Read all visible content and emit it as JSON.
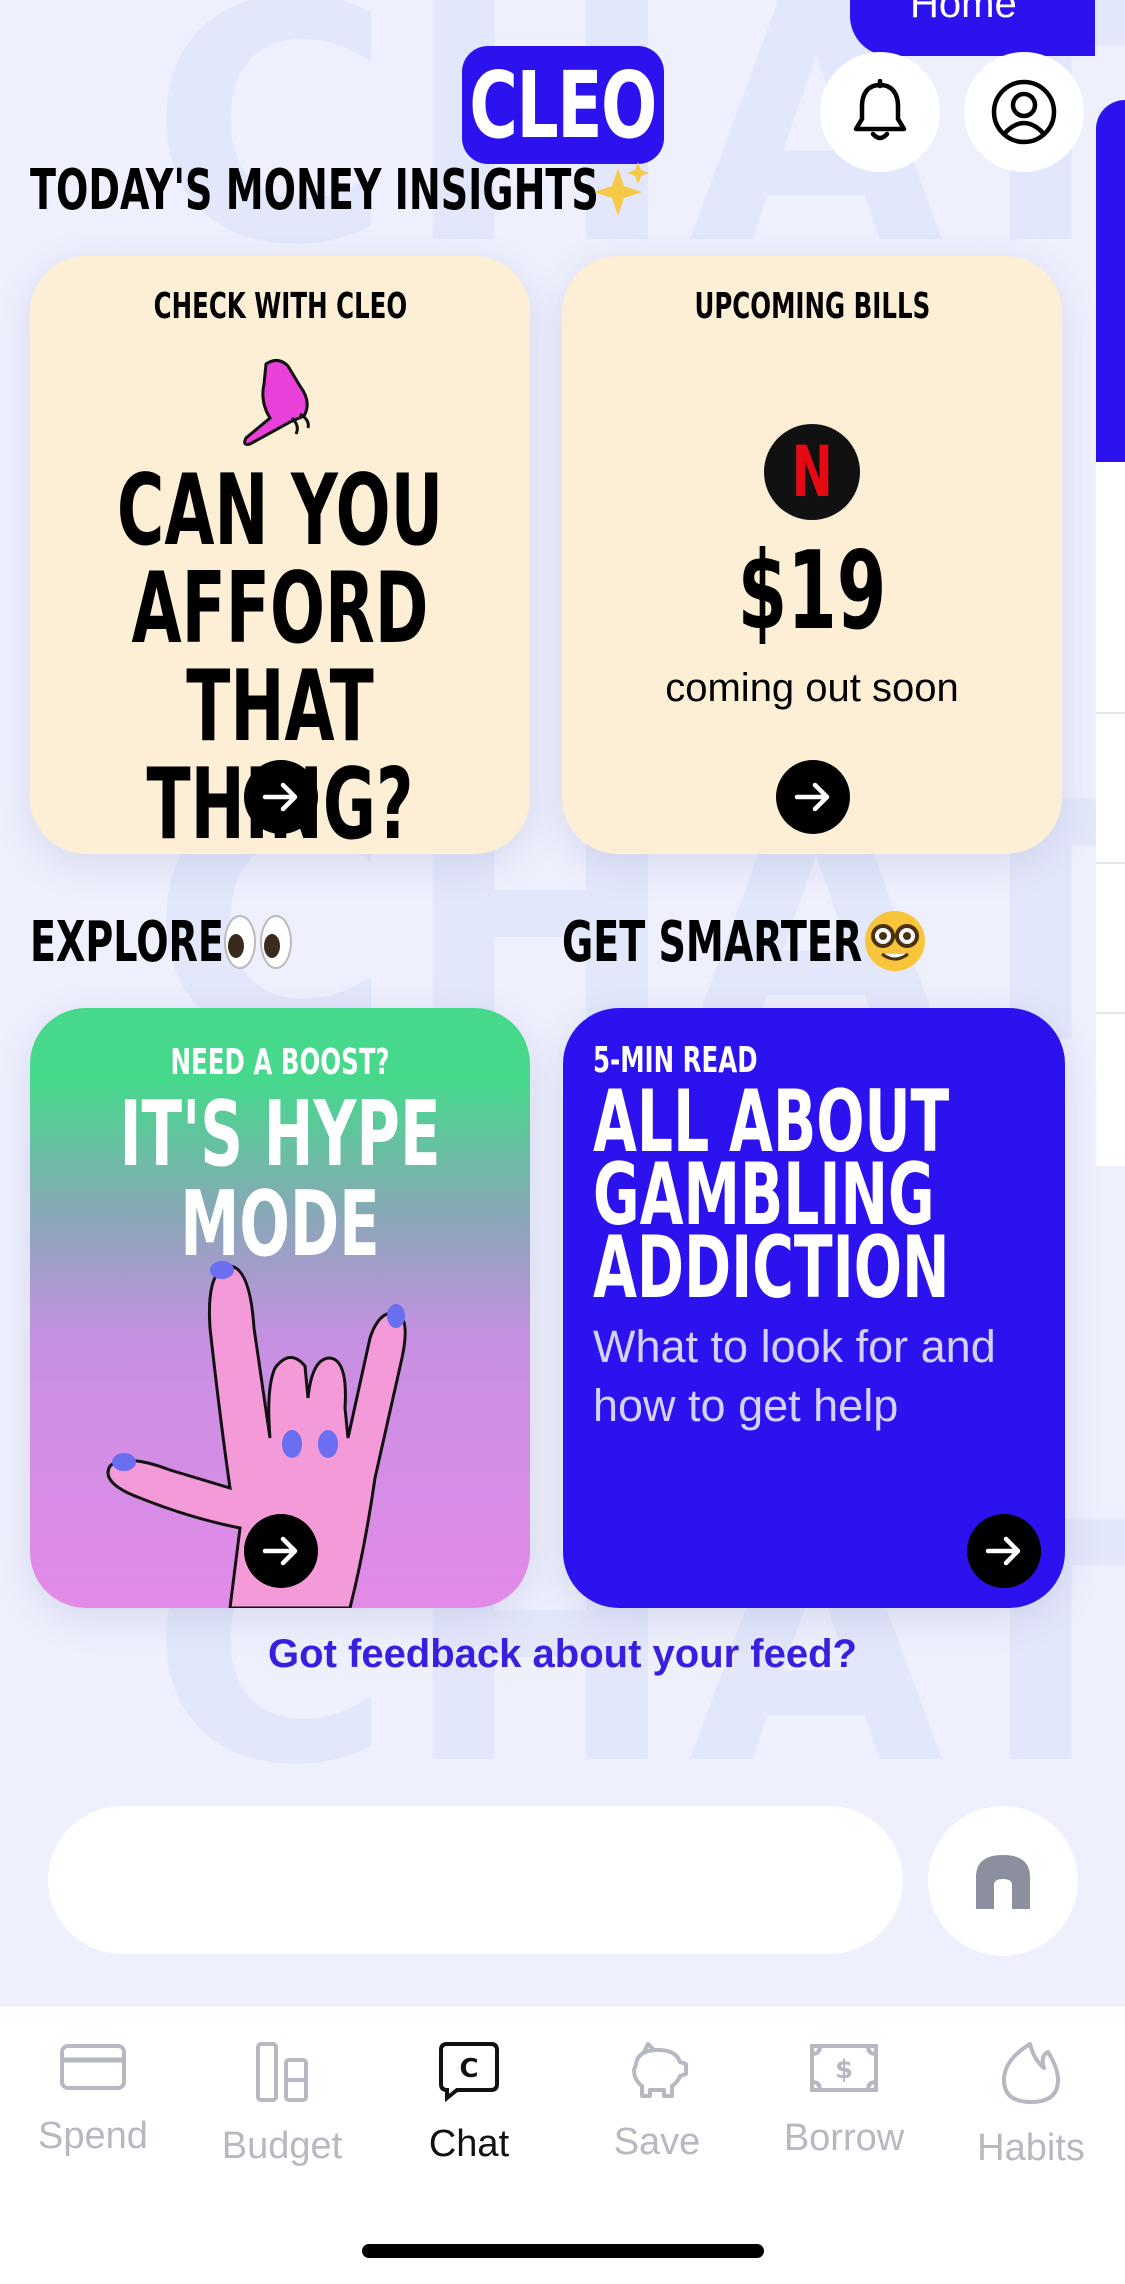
{
  "background_word": "CHAT",
  "header": {
    "logo_text": "CLEO",
    "home_pill_label": "Home"
  },
  "insights": {
    "title": "TODAY'S MONEY INSIGHTS",
    "title_emoji": "sparkles",
    "cards": [
      {
        "label": "CHECK WITH CLEO",
        "headline_lines": [
          "CAN YOU",
          "AFFORD",
          "THAT THING?"
        ]
      },
      {
        "label": "UPCOMING BILLS",
        "brand_letter": "N",
        "amount": "$19",
        "subtext": "coming out soon"
      }
    ]
  },
  "explore": {
    "title": "EXPLORE",
    "title_emoji": "eyes",
    "card": {
      "kicker": "NEED A BOOST?",
      "headline_lines": [
        "IT'S HYPE",
        "MODE"
      ]
    }
  },
  "smarter": {
    "title": "GET SMARTER",
    "title_emoji": "nerd-face",
    "card": {
      "kicker": "5-MIN READ",
      "headline_lines": [
        "ALL ABOUT",
        "GAMBLING",
        "ADDICTION"
      ],
      "subtext_lines": [
        "What to look for and",
        "how to get help"
      ]
    }
  },
  "feedback_link": "Got feedback about your feed?",
  "chat_input": {
    "placeholder": ""
  },
  "tabs": [
    {
      "label": "Spend",
      "icon": "card-icon"
    },
    {
      "label": "Budget",
      "icon": "budget-icon"
    },
    {
      "label": "Chat",
      "icon": "chat-icon",
      "active": true
    },
    {
      "label": "Save",
      "icon": "piggy-bank-icon"
    },
    {
      "label": "Borrow",
      "icon": "cash-icon"
    },
    {
      "label": "Habits",
      "icon": "flame-icon"
    }
  ],
  "colors": {
    "brand_blue": "#2c12ee",
    "cream": "#fdefd6",
    "green": "#48d78a",
    "pink": "#e088f0",
    "background": "#eef0fd",
    "netflix_red": "#e50914"
  }
}
